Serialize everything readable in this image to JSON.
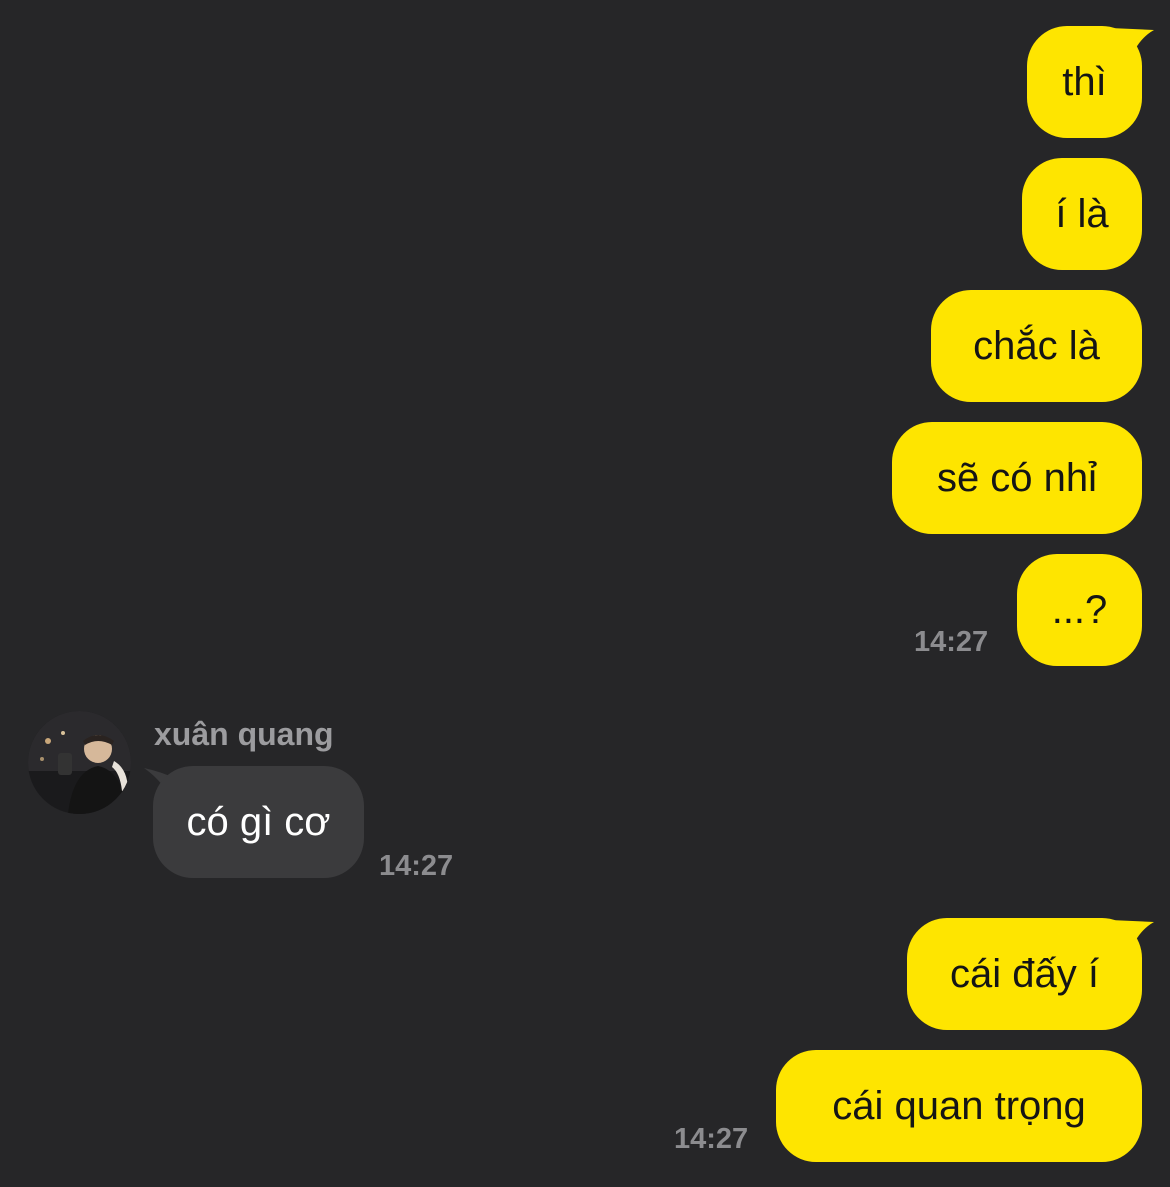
{
  "messages_top": [
    {
      "text": "thì"
    },
    {
      "text": "í là"
    },
    {
      "text": "chắc là"
    },
    {
      "text": "sẽ có nhỉ"
    },
    {
      "text": "...?"
    }
  ],
  "time_top": "14:27",
  "incoming": {
    "sender": "xuân quang",
    "text": "có gì cơ",
    "time": "14:27"
  },
  "messages_bottom": [
    {
      "text": "cái đấy í"
    },
    {
      "text": "cái quan trọng"
    }
  ],
  "time_bottom": "14:27",
  "colors": {
    "background": "#262628",
    "outgoing_bubble": "#FEE500",
    "incoming_bubble": "#3B3B3D",
    "timestamp": "#8C8C8F"
  }
}
